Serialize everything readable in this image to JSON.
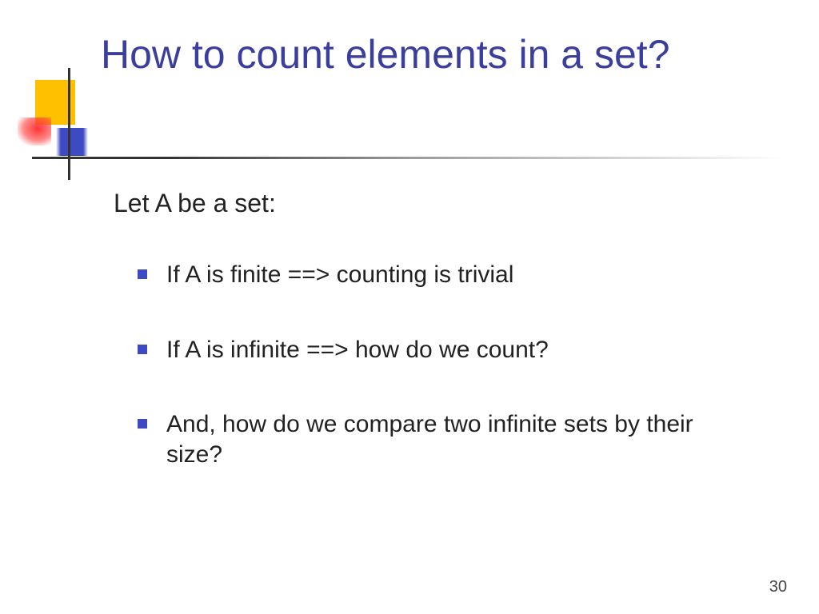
{
  "title": "How to count elements in a set?",
  "lead": "Let A be a set:",
  "bullets": [
    "If A is finite  ==> counting is trivial",
    "If A is infinite ==> how do we count?",
    "And, how do we compare two infinite sets by their size?"
  ],
  "page_number": "30"
}
